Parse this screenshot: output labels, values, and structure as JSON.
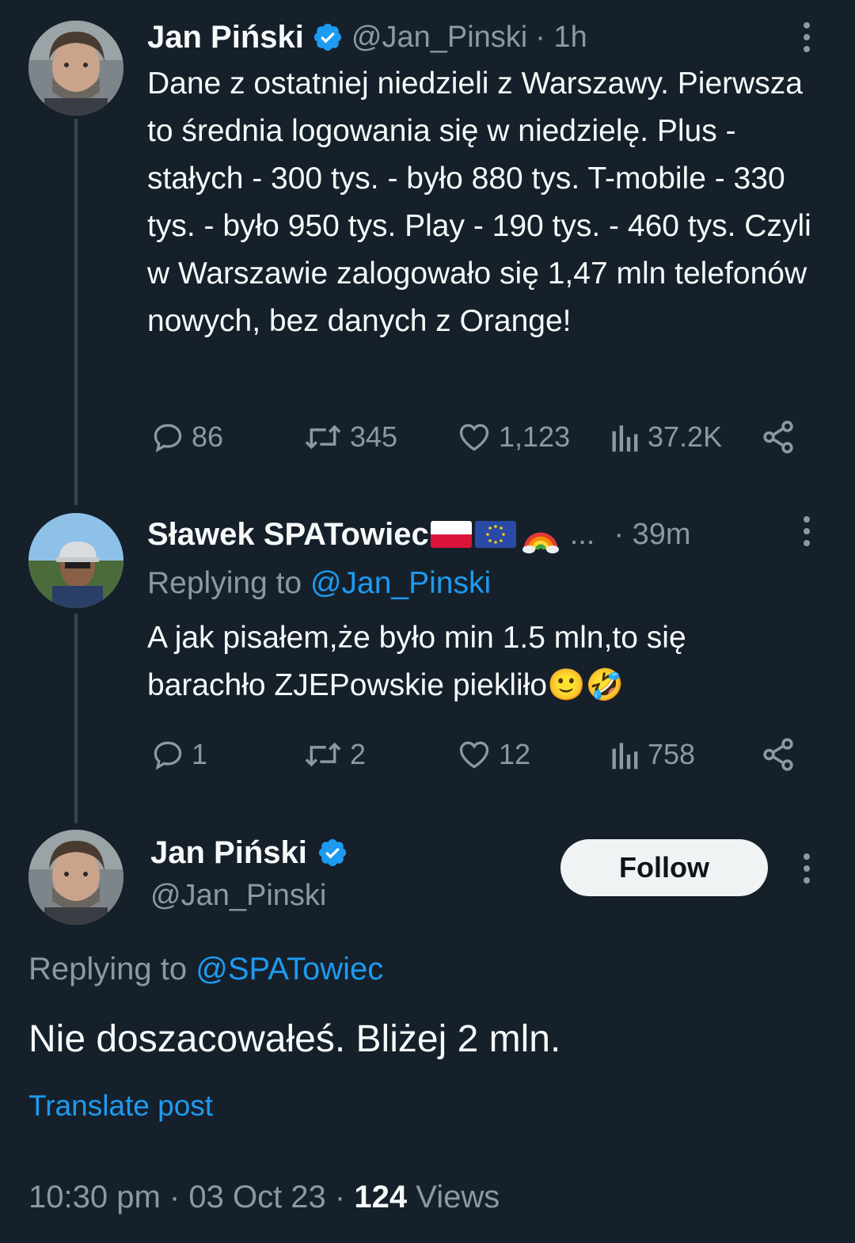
{
  "tweet1": {
    "name": "Jan Piński",
    "handle": "@Jan_Pinski",
    "time": "· 1h",
    "text": "Dane z ostatniej niedzieli z Warszawy. Pierwsza to średnia logowania się w niedzielę. Plus - stałych - 300 tys. - było 880 tys. T-mobile - 330 tys. - było 950 tys. Play - 190 tys. - 460 tys. Czyli w Warszawie zalogowało się 1,47 mln telefonów nowych, bez danych z Orange!",
    "replies": "86",
    "reposts": "345",
    "likes": "1,123",
    "views": "37.2K"
  },
  "tweet2": {
    "name": "Sławek SPATowiec",
    "ellipsis": "...",
    "time": "· 39m",
    "replying_prefix": "Replying to ",
    "replying_handle": "@Jan_Pinski",
    "text": "A jak pisałem,że było min 1.5 mln,to się barachło ZJEPowskie piekliło🙂🤣",
    "replies": "1",
    "reposts": "2",
    "likes": "12",
    "views": "758"
  },
  "main": {
    "name": "Jan Piński",
    "handle": "@Jan_Pinski",
    "follow_label": "Follow",
    "replying_prefix": "Replying to ",
    "replying_handle": "@SPATowiec",
    "text": "Nie doszacowałeś. Bliżej 2 mln.",
    "translate": "Translate post",
    "time": "10:30 pm",
    "sep1": "·",
    "date": "03 Oct 23",
    "sep2": "·",
    "views_count": "124",
    "views_label": "Views"
  },
  "colors": {
    "background": "#15202b",
    "text": "#f7f9f9",
    "muted": "#8b98a5",
    "accent": "#1d9bf0"
  }
}
